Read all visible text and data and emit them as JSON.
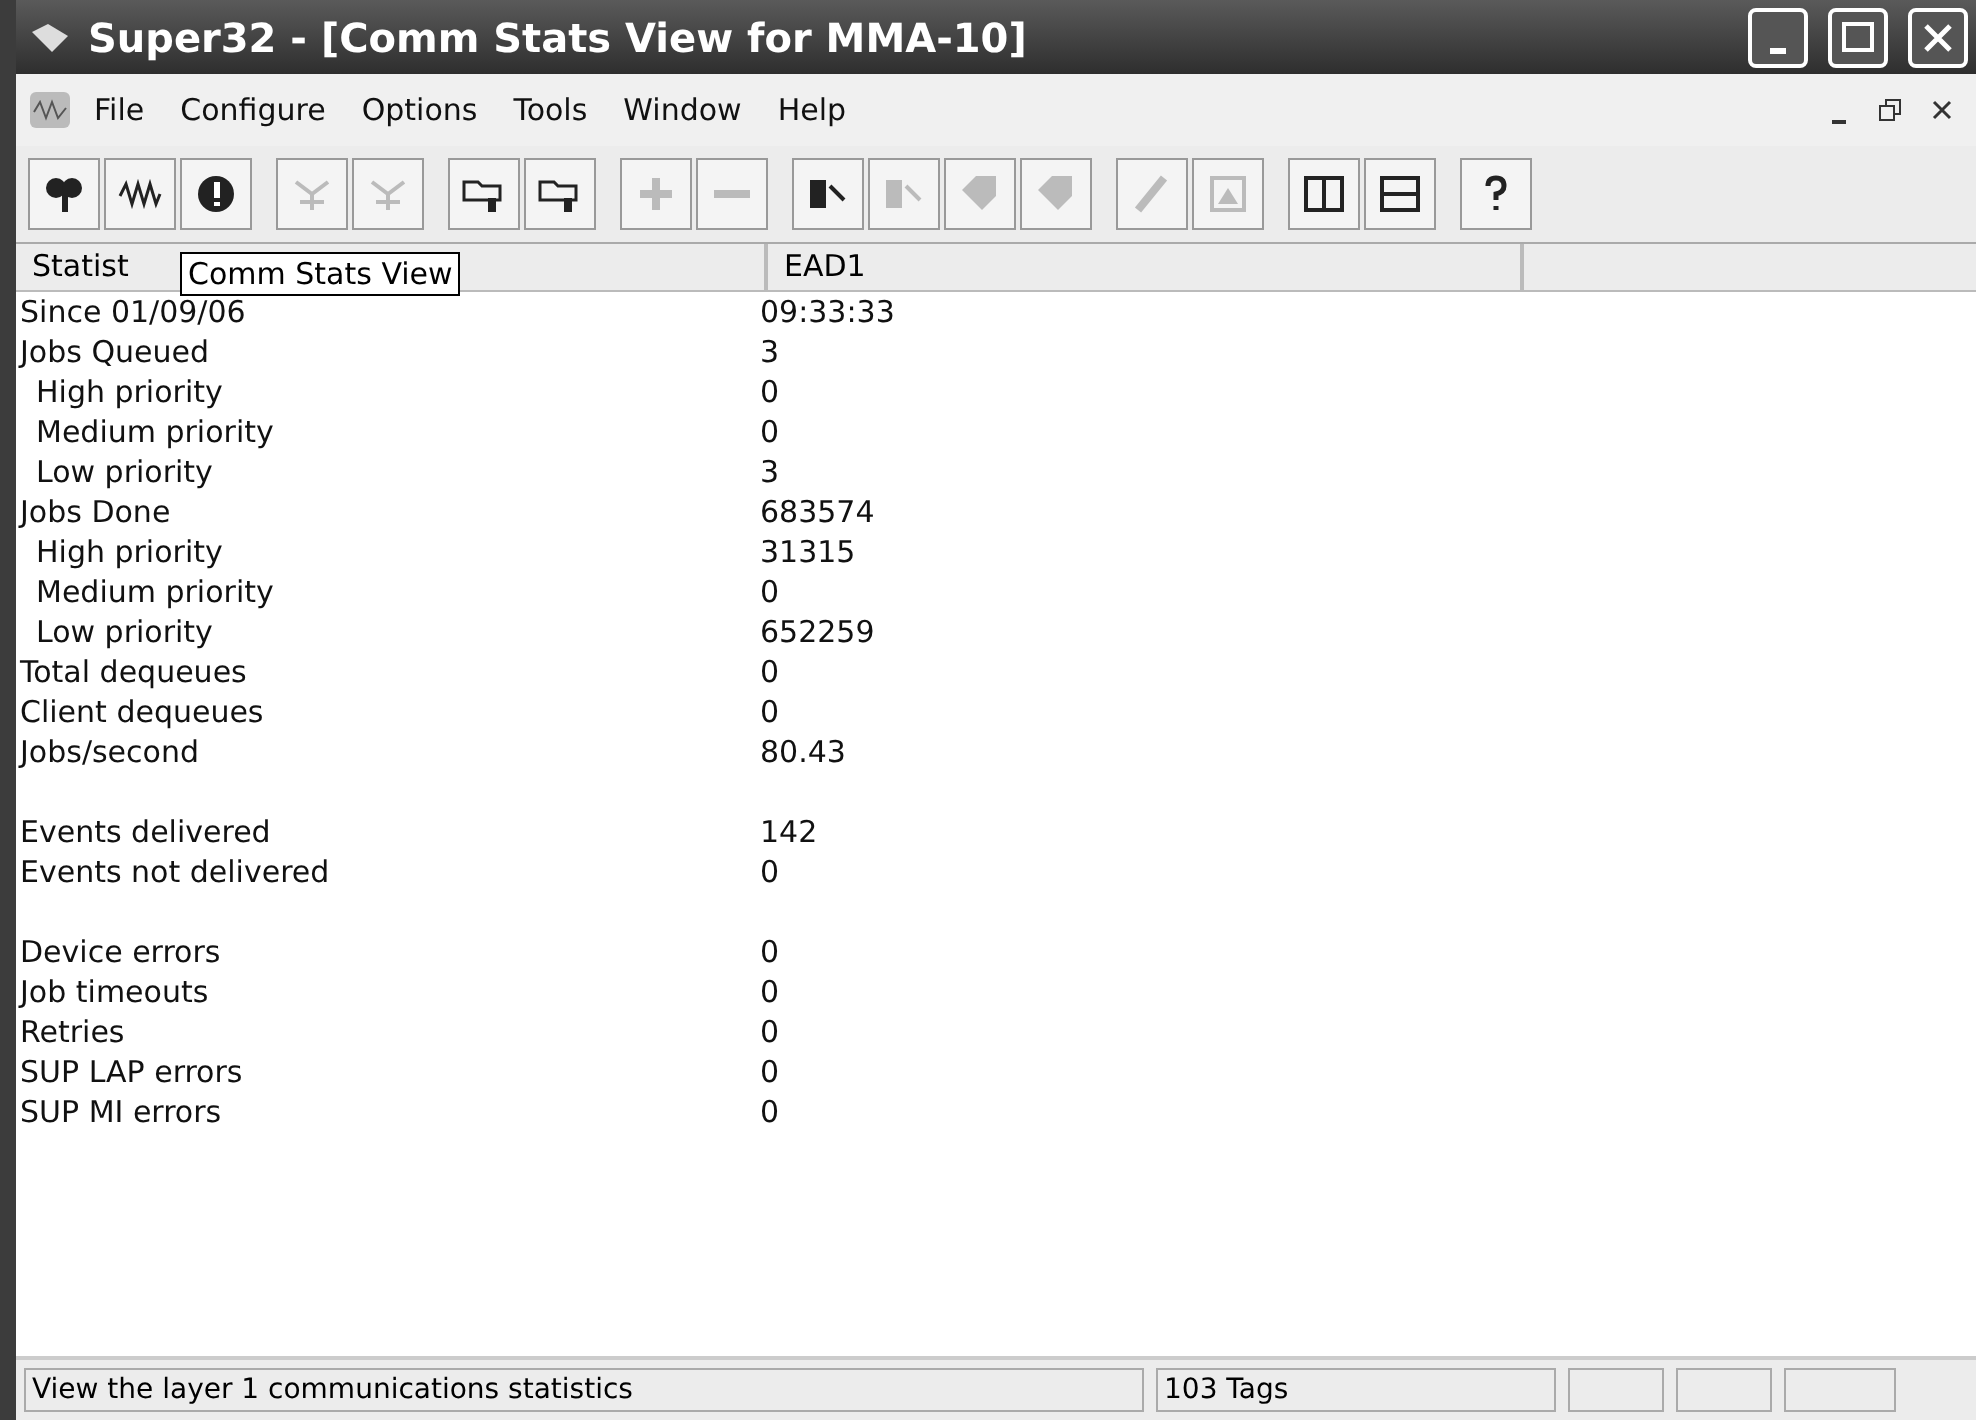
{
  "window": {
    "title": "Super32 - [Comm Stats View for MMA-10]"
  },
  "menu": [
    "File",
    "Configure",
    "Options",
    "Tools",
    "Window",
    "Help"
  ],
  "toolbar": [
    [
      {
        "disabled": false
      },
      {
        "disabled": false
      },
      {
        "disabled": false
      }
    ],
    [
      {
        "disabled": true
      },
      {
        "disabled": true
      }
    ],
    [
      {
        "disabled": false
      },
      {
        "disabled": false
      }
    ],
    [
      {
        "disabled": true
      },
      {
        "disabled": true
      }
    ],
    [
      {
        "disabled": false
      },
      {
        "disabled": true
      },
      {
        "disabled": true
      },
      {
        "disabled": true
      }
    ],
    [
      {
        "disabled": true
      },
      {
        "disabled": true
      }
    ],
    [
      {
        "disabled": false
      },
      {
        "disabled": false
      }
    ],
    [
      {
        "disabled": false
      }
    ]
  ],
  "table": {
    "columns": [
      "Statist",
      "EAD1"
    ],
    "sections": [
      [
        {
          "label": "Since 01/09/06",
          "value": "09:33:33"
        },
        {
          "label": "Jobs Queued",
          "value": "3",
          "children": [
            {
              "label": "High priority",
              "value": "0"
            },
            {
              "label": "Medium priority",
              "value": "0"
            },
            {
              "label": "Low priority",
              "value": "3"
            }
          ]
        },
        {
          "label": "Jobs Done",
          "value": "683574",
          "children": [
            {
              "label": "High priority",
              "value": "31315"
            },
            {
              "label": "Medium priority",
              "value": "0"
            },
            {
              "label": "Low priority",
              "value": "652259"
            }
          ]
        },
        {
          "label": "Total dequeues",
          "value": "0"
        },
        {
          "label": "Client dequeues",
          "value": "0"
        },
        {
          "label": "Jobs/second",
          "value": "80.43"
        }
      ],
      [
        {
          "label": "Events delivered",
          "value": "142"
        },
        {
          "label": "Events not delivered",
          "value": "0"
        }
      ],
      [
        {
          "label": "Device errors",
          "value": "0"
        },
        {
          "label": "Job timeouts",
          "value": "0"
        },
        {
          "label": "Retries",
          "value": "0"
        },
        {
          "label": "SUP LAP errors",
          "value": "0"
        },
        {
          "label": "SUP MI errors",
          "value": "0"
        }
      ]
    ]
  },
  "tooltip": "Comm Stats View",
  "status_bar": [
    "View the layer 1 communications statistics",
    "103 Tags"
  ]
}
